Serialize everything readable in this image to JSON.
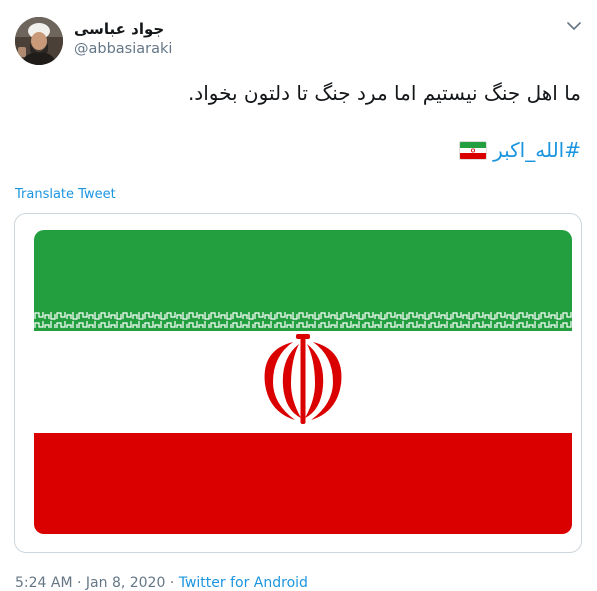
{
  "user": {
    "display_name": "جواد عباسی",
    "handle": "@abbasiaraki"
  },
  "tweet": {
    "text": "ما اهل جنگ نیستیم اما مرد جنگ تا دلتون بخواد.",
    "hashtag": "#الله_اکبر",
    "translate_label": "Translate Tweet"
  },
  "media": {
    "description_icon": "iran-flag",
    "colors": {
      "green": "#239f40",
      "white": "#ffffff",
      "red": "#da0000"
    }
  },
  "meta": {
    "time": "5:24 AM",
    "separator1": "·",
    "date": "Jan 8, 2020",
    "separator2": "·",
    "source": "Twitter for Android"
  },
  "icons": {
    "caret": "chevron-down-icon"
  },
  "colors": {
    "link": "#1b95e0",
    "secondary": "#657786",
    "text": "#14171a",
    "border": "#ccd6dd"
  }
}
